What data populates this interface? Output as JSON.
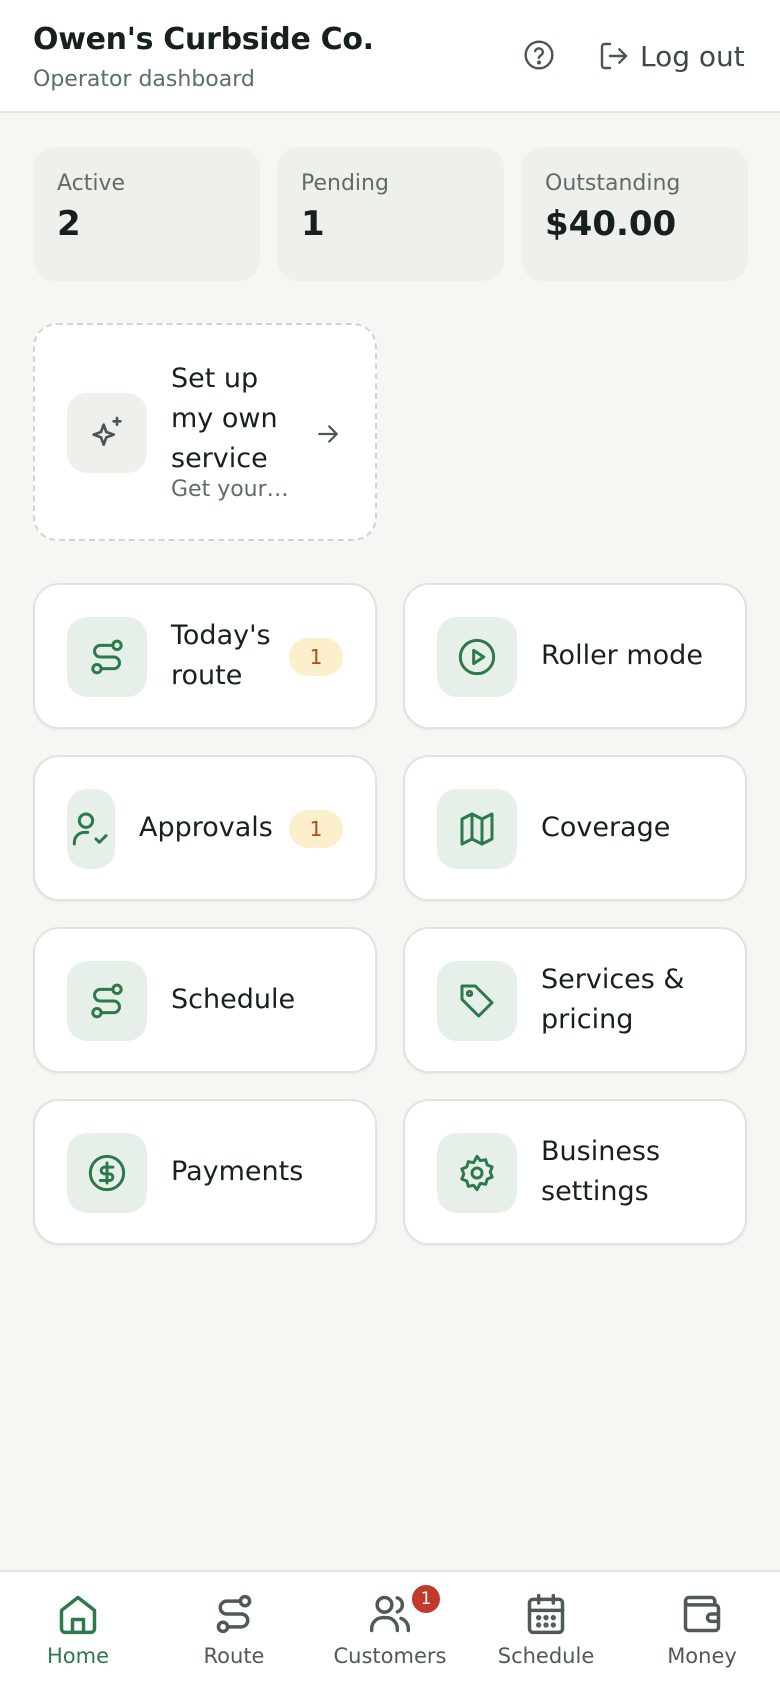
{
  "header": {
    "title": "Owen's Curbside Co.",
    "subtitle": "Operator dashboard",
    "help_icon": "help-circle-icon",
    "logout_label": "Log out"
  },
  "stats": [
    {
      "label": "Active",
      "value": "2"
    },
    {
      "label": "Pending",
      "value": "1"
    },
    {
      "label": "Outstanding",
      "value": "$40.00"
    }
  ],
  "setup": {
    "title": "Set up my own service",
    "subtitle": "Get your ...",
    "icon": "sparkles-icon"
  },
  "tiles": [
    {
      "label": "Today's route",
      "badge": "1",
      "icon": "route-icon"
    },
    {
      "label": "Roller mode",
      "icon": "play-circle-icon"
    },
    {
      "label": "Approvals",
      "badge": "1",
      "icon": "user-check-icon"
    },
    {
      "label": "Coverage",
      "icon": "map-icon"
    },
    {
      "label": "Schedule",
      "icon": "route-icon"
    },
    {
      "label": "Services & pricing",
      "icon": "tag-icon"
    },
    {
      "label": "Payments",
      "icon": "dollar-circle-icon"
    },
    {
      "label": "Business settings",
      "icon": "gear-icon"
    }
  ],
  "nav": [
    {
      "label": "Home",
      "icon": "home-icon",
      "active": true
    },
    {
      "label": "Route",
      "icon": "route-icon"
    },
    {
      "label": "Customers",
      "icon": "users-icon",
      "badge": "1"
    },
    {
      "label": "Schedule",
      "icon": "calendar-icon"
    },
    {
      "label": "Money",
      "icon": "wallet-icon"
    }
  ],
  "colors": {
    "accent": "#2c7a4b",
    "icon_bg": "#e6f0e9",
    "badge_bg": "#fbefcc",
    "badge_text": "#b04a1a",
    "nav_badge": "#c0392b"
  }
}
